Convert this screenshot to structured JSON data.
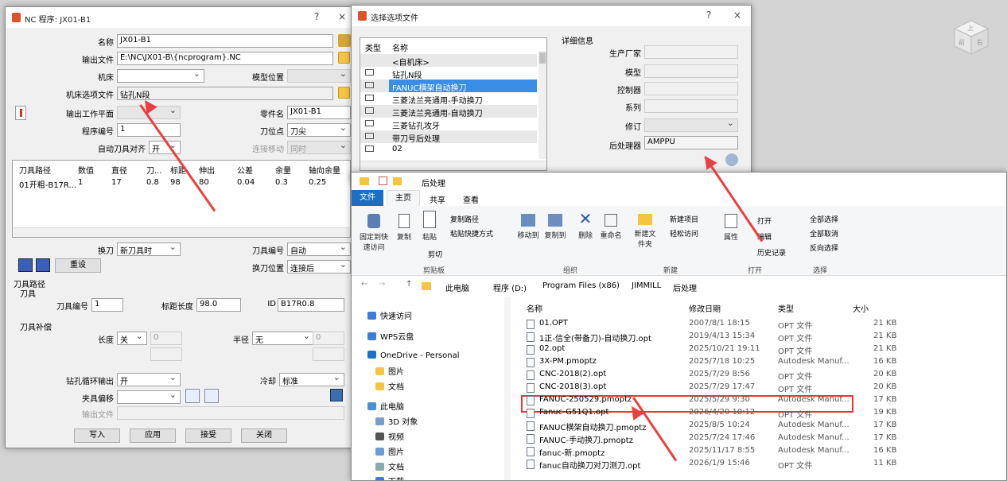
{
  "nc_dialog": {
    "title": "NC 程序:  JX01-B1",
    "help": "?",
    "close": "×",
    "name_label": "名称",
    "name_value": "JX01-B1",
    "output_file_label": "输出文件",
    "output_file_value": "E:\\NC\\JX01-B\\{ncprogram}.NC",
    "machine_label": "机床",
    "model_pos_label": "模型位置",
    "machine_option_label": "机床选项文件",
    "machine_option_value": "钻孔N段",
    "output_plane_label": "输出工作平面",
    "part_name_label": "零件名",
    "part_name_value": "JX01-B1",
    "program_no_label": "程序编号",
    "program_no_value": "1",
    "tool_point_label": "刀位点",
    "tool_point_value": "刀尖",
    "auto_align_label": "自动刀具对齐",
    "auto_align_value": "开",
    "connect_move_label": "连接移动",
    "connect_move_value": "同时",
    "table_headers": [
      "刀具路径",
      "数值",
      "直径",
      "刀...",
      "标距",
      "伸出",
      "公差",
      "余量",
      "轴向余量"
    ],
    "table_row": [
      "01开粗-B17R...",
      "1",
      "17",
      "0.8",
      "98",
      "80",
      "0.04",
      "0.3",
      "0.25"
    ],
    "tool_change_label": "换刀",
    "tool_change_value": "新刀具时",
    "tool_no_label": "刀具编号",
    "tool_no_value": "自动",
    "tool_change_pos_label": "换刀位置",
    "tool_change_pos_value": "连接后",
    "reset_label": "重设",
    "toolpath_section": "刀具路径",
    "tool_section": "刀具",
    "tool_number_label": "刀具编号",
    "tool_number_value": "1",
    "gauge_len_label": "标距长度",
    "gauge_len_value": "98.0",
    "id_label": "ID",
    "id_value": "B17R0.8",
    "comp_section": "刀具补偿",
    "length_label": "长度",
    "length_value": "关",
    "length_num": "0",
    "radius_label": "半径",
    "radius_value": "无",
    "radius_num": "0",
    "drill_cycle_label": "钻孔循环输出",
    "drill_cycle_value": "开",
    "coolant_label": "冷却",
    "coolant_value": "标准",
    "fixture_label": "夹具偏移",
    "out_file2_label": "输出文件",
    "buttons": [
      "写入",
      "应用",
      "接受",
      "关闭"
    ]
  },
  "opt_dialog": {
    "title": "选择选项文件",
    "help": "?",
    "close": "×",
    "col_type": "类型",
    "col_name": "名称",
    "items": [
      "<自机床>",
      "钻孔N段",
      "FANUC横架自动换刀",
      "三菱法兰亮通用-手动换刀",
      "三菱法兰亮通用-自动换刀",
      "三菱钻孔攻牙",
      "带刀号后处理",
      "02"
    ],
    "details_title": "详细信息",
    "manufacturer_label": "生产厂家",
    "model_label": "模型",
    "controller_label": "控制器",
    "series_label": "系列",
    "revision_label": "修订",
    "postproc_label": "后处理器",
    "postproc_value": "AMPPU"
  },
  "explorer": {
    "title": "后处理",
    "tabs": [
      "文件",
      "主页",
      "共享",
      "查看"
    ],
    "ribbon": {
      "pin": "固定到快速访问",
      "copy": "复制",
      "paste": "粘贴",
      "copy_path": "复制路径",
      "paste_shortcut": "粘贴快捷方式",
      "cut": "剪切",
      "group_clipboard": "剪贴板",
      "move_to": "移动到",
      "copy_to": "复制到",
      "delete": "删除",
      "rename": "重命名",
      "group_organize": "组织",
      "new_folder": "新建文件夹",
      "new_item": "新建项目",
      "easy_access": "轻松访问",
      "group_new": "新建",
      "properties": "属性",
      "open": "打开",
      "edit": "编辑",
      "history": "历史记录",
      "group_open": "打开",
      "select_all": "全部选择",
      "select_none": "全部取消",
      "invert": "反向选择",
      "group_select": "选择"
    },
    "breadcrumb": [
      "此电脑",
      "程序 (D:)",
      "Program Files (x86)",
      "JIMMILL",
      "后处理"
    ],
    "nav": [
      "快速访问",
      "WPS云盘",
      "OneDrive - Personal",
      "图片",
      "文档",
      "此电脑",
      "3D 对象",
      "视频",
      "图片",
      "文档",
      "下载"
    ],
    "columns": [
      "名称",
      "修改日期",
      "类型",
      "大小"
    ],
    "files": [
      {
        "name": "01.OPT",
        "date": "2007/8/1 18:15",
        "type": "OPT 文件",
        "size": "21 KB"
      },
      {
        "name": "1正-信全(带备刀)-自动换刀.opt",
        "date": "2019/4/13 15:34",
        "type": "OPT 文件",
        "size": "21 KB"
      },
      {
        "name": "02.opt",
        "date": "2025/10/21 19:11",
        "type": "OPT 文件",
        "size": "21 KB"
      },
      {
        "name": "3X-PM.pmoptz",
        "date": "2025/7/18 10:25",
        "type": "Autodesk Manuf...",
        "size": "16 KB"
      },
      {
        "name": "CNC-2018(2).opt",
        "date": "2025/7/29 8:56",
        "type": "OPT 文件",
        "size": "20 KB"
      },
      {
        "name": "CNC-2018(3).opt",
        "date": "2025/7/29 17:47",
        "type": "OPT 文件",
        "size": "20 KB"
      },
      {
        "name": "FANUC-250529.pmoptz",
        "date": "2025/5/29 9:30",
        "type": "Autodesk Manuf...",
        "size": "17 KB"
      },
      {
        "name": "Fanuc-G51Q1.opt",
        "date": "2026/4/20 10:12",
        "type": "OPT 文件",
        "size": "19 KB"
      },
      {
        "name": "FANUC横架自动换刀.pmoptz",
        "date": "2025/8/5 10:24",
        "type": "Autodesk Manuf...",
        "size": "17 KB"
      },
      {
        "name": "FANUC-手动换刀.pmoptz",
        "date": "2025/7/24 17:46",
        "type": "Autodesk Manuf...",
        "size": "17 KB"
      },
      {
        "name": "fanuc-新.pmoptz",
        "date": "2025/11/17 8:55",
        "type": "Autodesk Manuf...",
        "size": "16 KB"
      },
      {
        "name": "fanuc自动换刀对刀测刀.opt",
        "date": "2026/1/9 15:46",
        "type": "OPT 文件",
        "size": "11 KB"
      }
    ]
  },
  "viewcube": {
    "top": "上",
    "front": "前",
    "right": "右"
  }
}
